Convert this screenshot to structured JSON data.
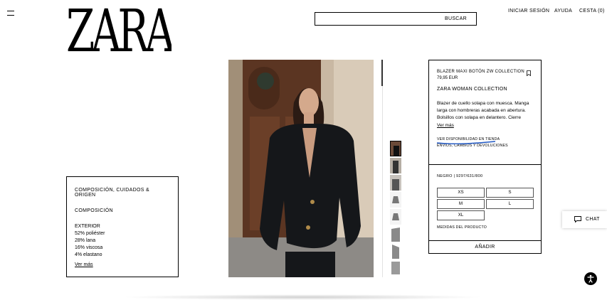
{
  "header": {
    "brand": "ZARA",
    "search_button": "BUSCAR",
    "nav": {
      "login": "INICIAR SESIÓN",
      "help": "AYUDA",
      "cart": "CESTA (0)"
    }
  },
  "composition": {
    "title": "COMPOSICIÓN, CUIDADOS & ORIGEN",
    "subtitle": "COMPOSICIÓN",
    "section": "EXTERIOR",
    "materials": [
      "52% poliéster",
      "28% lana",
      "16% viscosa",
      "4% elastano"
    ],
    "more": "Ver más"
  },
  "product": {
    "name": "BLAZER MAXI BOTÓN ZW COLLECTION",
    "price": "79,95 EUR",
    "collection": "ZARA WOMAN COLLECTION",
    "description": "Blazer de cuello solapa con muesca. Manga larga con hombreras acabada en abertura. Bolsillos con solapa en delantero. Cierre",
    "more": "Ver más",
    "store_availability": "VER DISPONIBILIDAD EN TIENDA",
    "shipping": "ENVÍOS, CAMBIOS Y DEVOLUCIONES",
    "color_ref": "NEGRO | 9297/631/800",
    "sizes": [
      "XS",
      "S",
      "M",
      "L",
      "XL"
    ],
    "measures": "MEDIDAS DEL PRODUCTO",
    "add": "AÑADIR",
    "highlight_color": "#1f57c3"
  },
  "chat": {
    "label": "CHAT"
  },
  "icons": [
    "menu-icon",
    "bookmark-icon",
    "chat-icon",
    "accessibility-icon"
  ]
}
